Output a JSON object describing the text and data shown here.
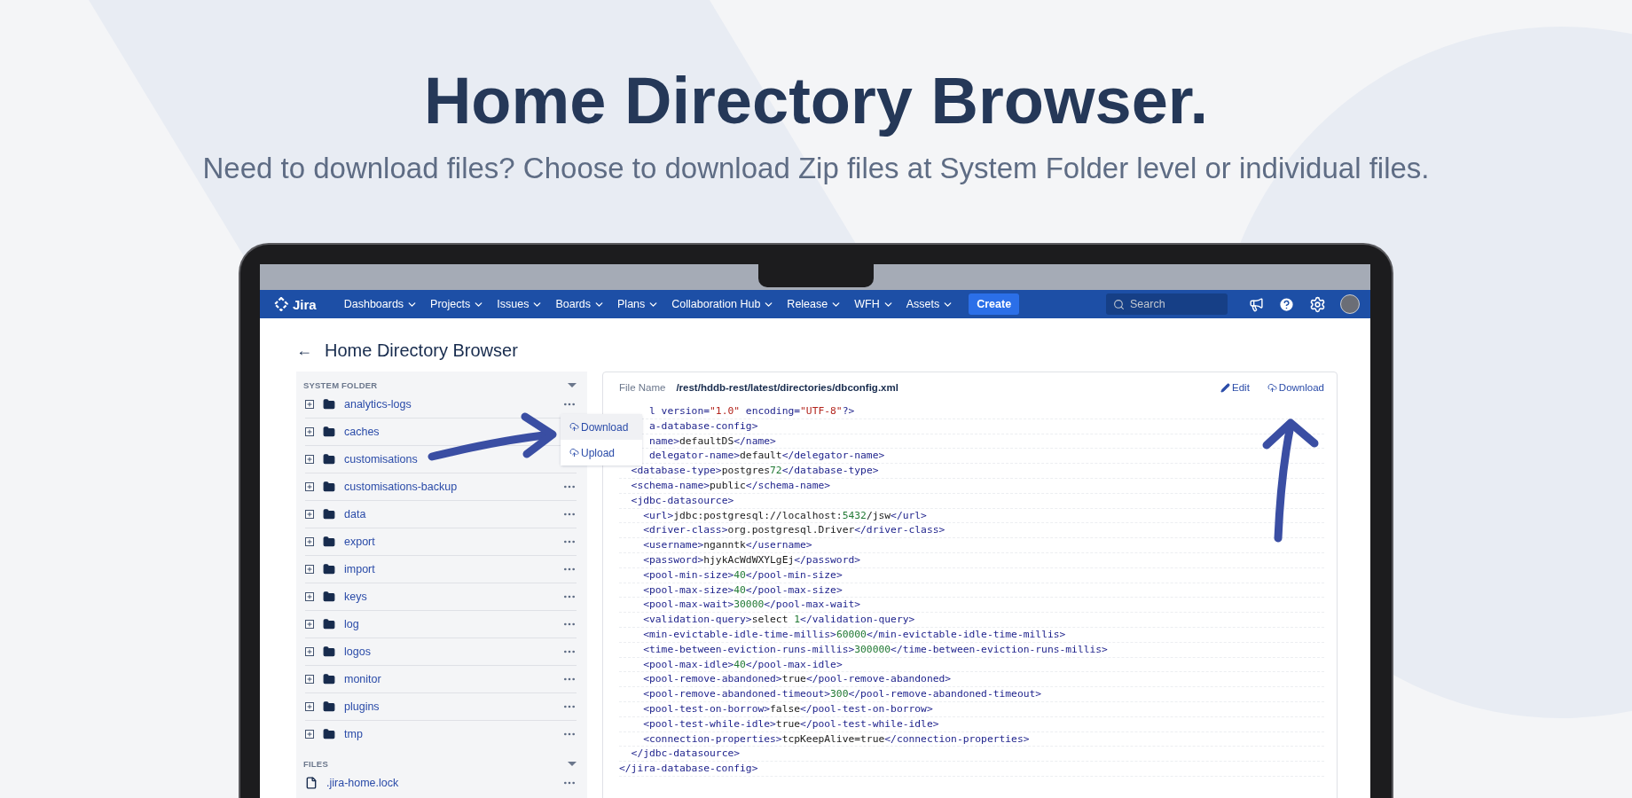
{
  "hero": {
    "title": "Home Directory Browser.",
    "subtitle": "Need to download files? Choose to download Zip files at System Folder level or individual files."
  },
  "nav": {
    "logo": "Jira",
    "items": [
      {
        "label": "Dashboards"
      },
      {
        "label": "Projects"
      },
      {
        "label": "Issues"
      },
      {
        "label": "Boards"
      },
      {
        "label": "Plans"
      },
      {
        "label": "Collaboration Hub"
      },
      {
        "label": "Release"
      },
      {
        "label": "WFH"
      },
      {
        "label": "Assets"
      }
    ],
    "create": "Create",
    "search": {
      "placeholder": "Search"
    }
  },
  "page": {
    "back": "←",
    "title": "Home Directory Browser"
  },
  "sidebar": {
    "sections": [
      {
        "title": "SYSTEM FOLDER",
        "items": [
          {
            "kind": "folder",
            "name": "analytics-logs",
            "more": true
          },
          {
            "kind": "folder",
            "name": "caches",
            "more": false
          },
          {
            "kind": "folder",
            "name": "customisations",
            "more": false
          },
          {
            "kind": "folder",
            "name": "customisations-backup",
            "more": true
          },
          {
            "kind": "folder",
            "name": "data",
            "more": true
          },
          {
            "kind": "folder",
            "name": "export",
            "more": true
          },
          {
            "kind": "folder",
            "name": "import",
            "more": true
          },
          {
            "kind": "folder",
            "name": "keys",
            "more": true
          },
          {
            "kind": "folder",
            "name": "log",
            "more": true
          },
          {
            "kind": "folder",
            "name": "logos",
            "more": true
          },
          {
            "kind": "folder",
            "name": "monitor",
            "more": true
          },
          {
            "kind": "folder",
            "name": "plugins",
            "more": true
          },
          {
            "kind": "folder",
            "name": "tmp",
            "more": true
          }
        ]
      },
      {
        "title": "FILES",
        "items": [
          {
            "kind": "file",
            "name": ".jira-home.lock",
            "more": true
          }
        ]
      }
    ]
  },
  "row_menu": {
    "items": [
      {
        "label": "Download",
        "selected": true
      },
      {
        "label": "Upload",
        "selected": false
      }
    ]
  },
  "file_viewer": {
    "label": "File Name",
    "path": "/rest/hddb-rest/latest/directories/dbconfig.xml",
    "actions": [
      {
        "kind": "edit",
        "label": "Edit"
      },
      {
        "kind": "download",
        "label": "Download"
      }
    ],
    "lines": [
      "     l version=\"1.0\" encoding=\"UTF-8\"?>",
      "     a-database-config>",
      "     name>defaultDS</name>",
      "     delegator-name>default</delegator-name>",
      "  <database-type>postgres72</database-type>",
      "  <schema-name>public</schema-name>",
      "  <jdbc-datasource>",
      "    <url>jdbc:postgresql://localhost:5432/jsw</url>",
      "    <driver-class>org.postgresql.Driver</driver-class>",
      "    <username>nganntk</username>",
      "    <password>hjykAcWdWXYLgEj</password>",
      "    <pool-min-size>40</pool-min-size>",
      "    <pool-max-size>40</pool-max-size>",
      "    <pool-max-wait>30000</pool-max-wait>",
      "    <validation-query>select 1</validation-query>",
      "    <min-evictable-idle-time-millis>60000</min-evictable-idle-time-millis>",
      "    <time-between-eviction-runs-millis>300000</time-between-eviction-runs-millis>",
      "    <pool-max-idle>40</pool-max-idle>",
      "    <pool-remove-abandoned>true</pool-remove-abandoned>",
      "    <pool-remove-abandoned-timeout>300</pool-remove-abandoned-timeout>",
      "    <pool-test-on-borrow>false</pool-test-on-borrow>",
      "    <pool-test-while-idle>true</pool-test-while-idle>",
      "    <connection-properties>tcpKeepAlive=true</connection-properties>",
      "  </jdbc-datasource>",
      "</jira-database-config>"
    ]
  }
}
